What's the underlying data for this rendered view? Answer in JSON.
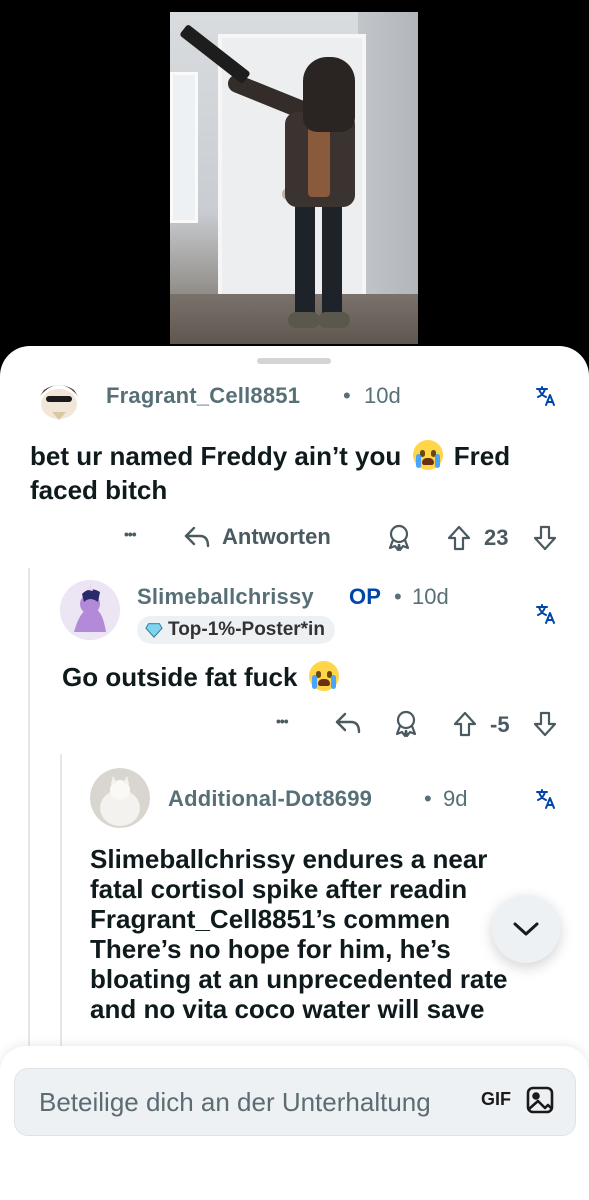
{
  "comments": [
    {
      "username": "Fragrant_Cell8851",
      "time": "10d",
      "text_before_emoji": "bet ur named Freddy ain’t you",
      "text_after_emoji": "Fred",
      "text_line2": "faced bitch",
      "reply_label": "Antworten",
      "score": "23"
    },
    {
      "username": "Slimeballchrissy",
      "op_label": "OP",
      "time": "10d",
      "flair": "Top-1%-Poster*in",
      "text": "Go outside fat fuck",
      "score": "-5"
    },
    {
      "username": "Additional-Dot8699",
      "time": "9d",
      "lines": [
        "Slimeballchrissy endures a near",
        "fatal cortisol spike after readin",
        "Fragrant_Cell8851’s commen",
        "There’s no hope for him, he’s",
        "bloating at an unprecedented rate",
        "and no vita coco water will save"
      ]
    }
  ],
  "separator": "•",
  "overflow_glyph": "•••",
  "composer": {
    "placeholder": "Beteilige dich an der Unterhaltung",
    "gif_label": "GIF"
  },
  "colors": {
    "accent": "#0045ac",
    "meta": "#576f76",
    "surface": "#eef1f3"
  }
}
